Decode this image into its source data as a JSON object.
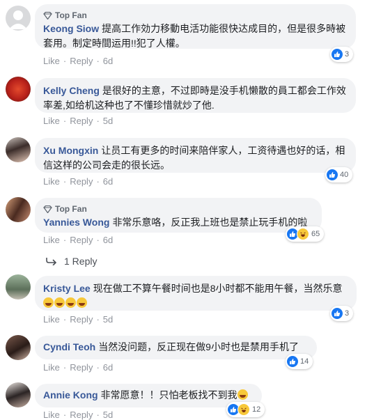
{
  "labels": {
    "like": "Like",
    "reply": "Reply",
    "top_fan": "Top Fan"
  },
  "comments": [
    {
      "author": "Keong Siow",
      "text": "提高工作効力移動电活功能很快达成目的，但是很多時被套用。制定時間运用!!犯了人權。",
      "time": "6d",
      "top_fan": true,
      "reactions": "3"
    },
    {
      "author": "Kelly Cheng",
      "text": "是很好的主意，不过即時是没手机懒散的員工都会工作效率差,如给机这种也了不懂珍惜就炒了他.",
      "time": "5d",
      "top_fan": false,
      "reactions": ""
    },
    {
      "author": "Xu Mongxin",
      "text": "让员工有更多的时间来陪伴家人，工资待遇也好的话，相信这样的公司会走的很长远。",
      "time": "6d",
      "top_fan": false,
      "reactions": "40"
    },
    {
      "author": "Yannies Wong",
      "text": "非常乐意咯，反正我上班也是禁止玩手机的啦",
      "time": "6d",
      "top_fan": true,
      "reactions": "65",
      "replies": "1 Reply"
    },
    {
      "author": "Kristy Lee",
      "text": "现在做工不算午餐时间也是8小时都不能用午餐，当然乐意",
      "time": "5d",
      "top_fan": false,
      "reactions": "3"
    },
    {
      "author": "Cyndi Teoh",
      "text": "当然没问题，反正现在做9小时也是禁用手机了",
      "time": "6d",
      "top_fan": false,
      "reactions": "14"
    },
    {
      "author": "Annie Kong",
      "text": "非常愿意！！只怕老板找不到我",
      "time": "5d",
      "top_fan": false,
      "reactions": "12"
    }
  ],
  "colors": {
    "author": "#385898",
    "bubble": "#f2f3f5",
    "like": "#1877f2",
    "meta": "#90949c"
  }
}
